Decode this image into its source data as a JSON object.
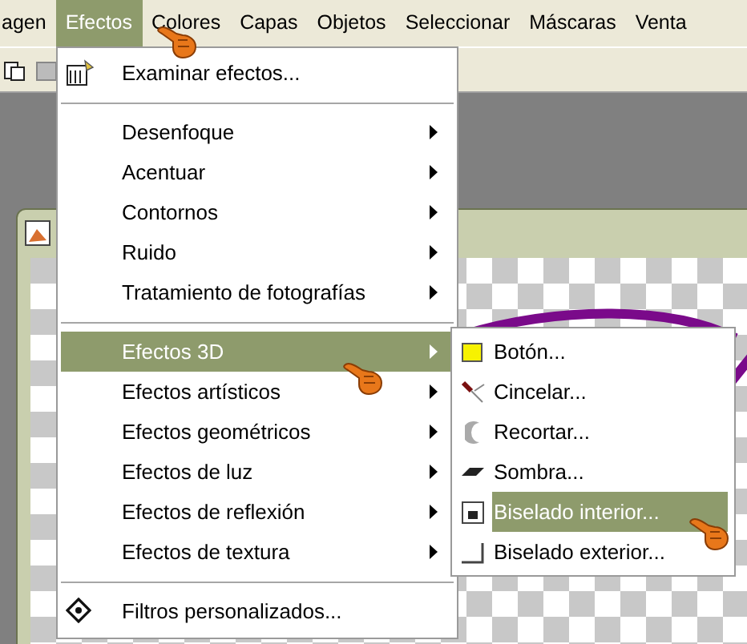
{
  "menubar": [
    {
      "label": "agen",
      "selected": false
    },
    {
      "label": "Efectos",
      "selected": true
    },
    {
      "label": "Colores",
      "selected": false
    },
    {
      "label": "Capas",
      "selected": false
    },
    {
      "label": "Objetos",
      "selected": false
    },
    {
      "label": "Seleccionar",
      "selected": false
    },
    {
      "label": "Máscaras",
      "selected": false
    },
    {
      "label": "Venta",
      "selected": false
    }
  ],
  "menu": {
    "items": [
      {
        "kind": "command",
        "label": "Examinar efectos...",
        "selected": false
      },
      {
        "kind": "separator"
      },
      {
        "kind": "submenu",
        "label": "Desenfoque",
        "selected": false
      },
      {
        "kind": "submenu",
        "label": "Acentuar",
        "selected": false
      },
      {
        "kind": "submenu",
        "label": "Contornos",
        "selected": false
      },
      {
        "kind": "submenu",
        "label": "Ruido",
        "selected": false
      },
      {
        "kind": "submenu",
        "label": "Tratamiento de fotografías",
        "selected": false
      },
      {
        "kind": "separator"
      },
      {
        "kind": "submenu",
        "label": "Efectos 3D",
        "selected": true
      },
      {
        "kind": "submenu",
        "label": "Efectos artísticos",
        "selected": false
      },
      {
        "kind": "submenu",
        "label": "Efectos geométricos",
        "selected": false
      },
      {
        "kind": "submenu",
        "label": "Efectos de luz",
        "selected": false
      },
      {
        "kind": "submenu",
        "label": "Efectos de reflexión",
        "selected": false
      },
      {
        "kind": "submenu",
        "label": "Efectos de textura",
        "selected": false
      },
      {
        "kind": "separator"
      },
      {
        "kind": "command",
        "label": "Filtros personalizados...",
        "selected": false
      }
    ]
  },
  "submenu": {
    "items": [
      {
        "label": "Botón...",
        "selected": false
      },
      {
        "label": "Cincelar...",
        "selected": false
      },
      {
        "label": "Recortar...",
        "selected": false
      },
      {
        "label": "Sombra...",
        "selected": false
      },
      {
        "label": "Biselado interior...",
        "selected": true
      },
      {
        "label": "Biselado exterior...",
        "selected": false
      }
    ]
  }
}
